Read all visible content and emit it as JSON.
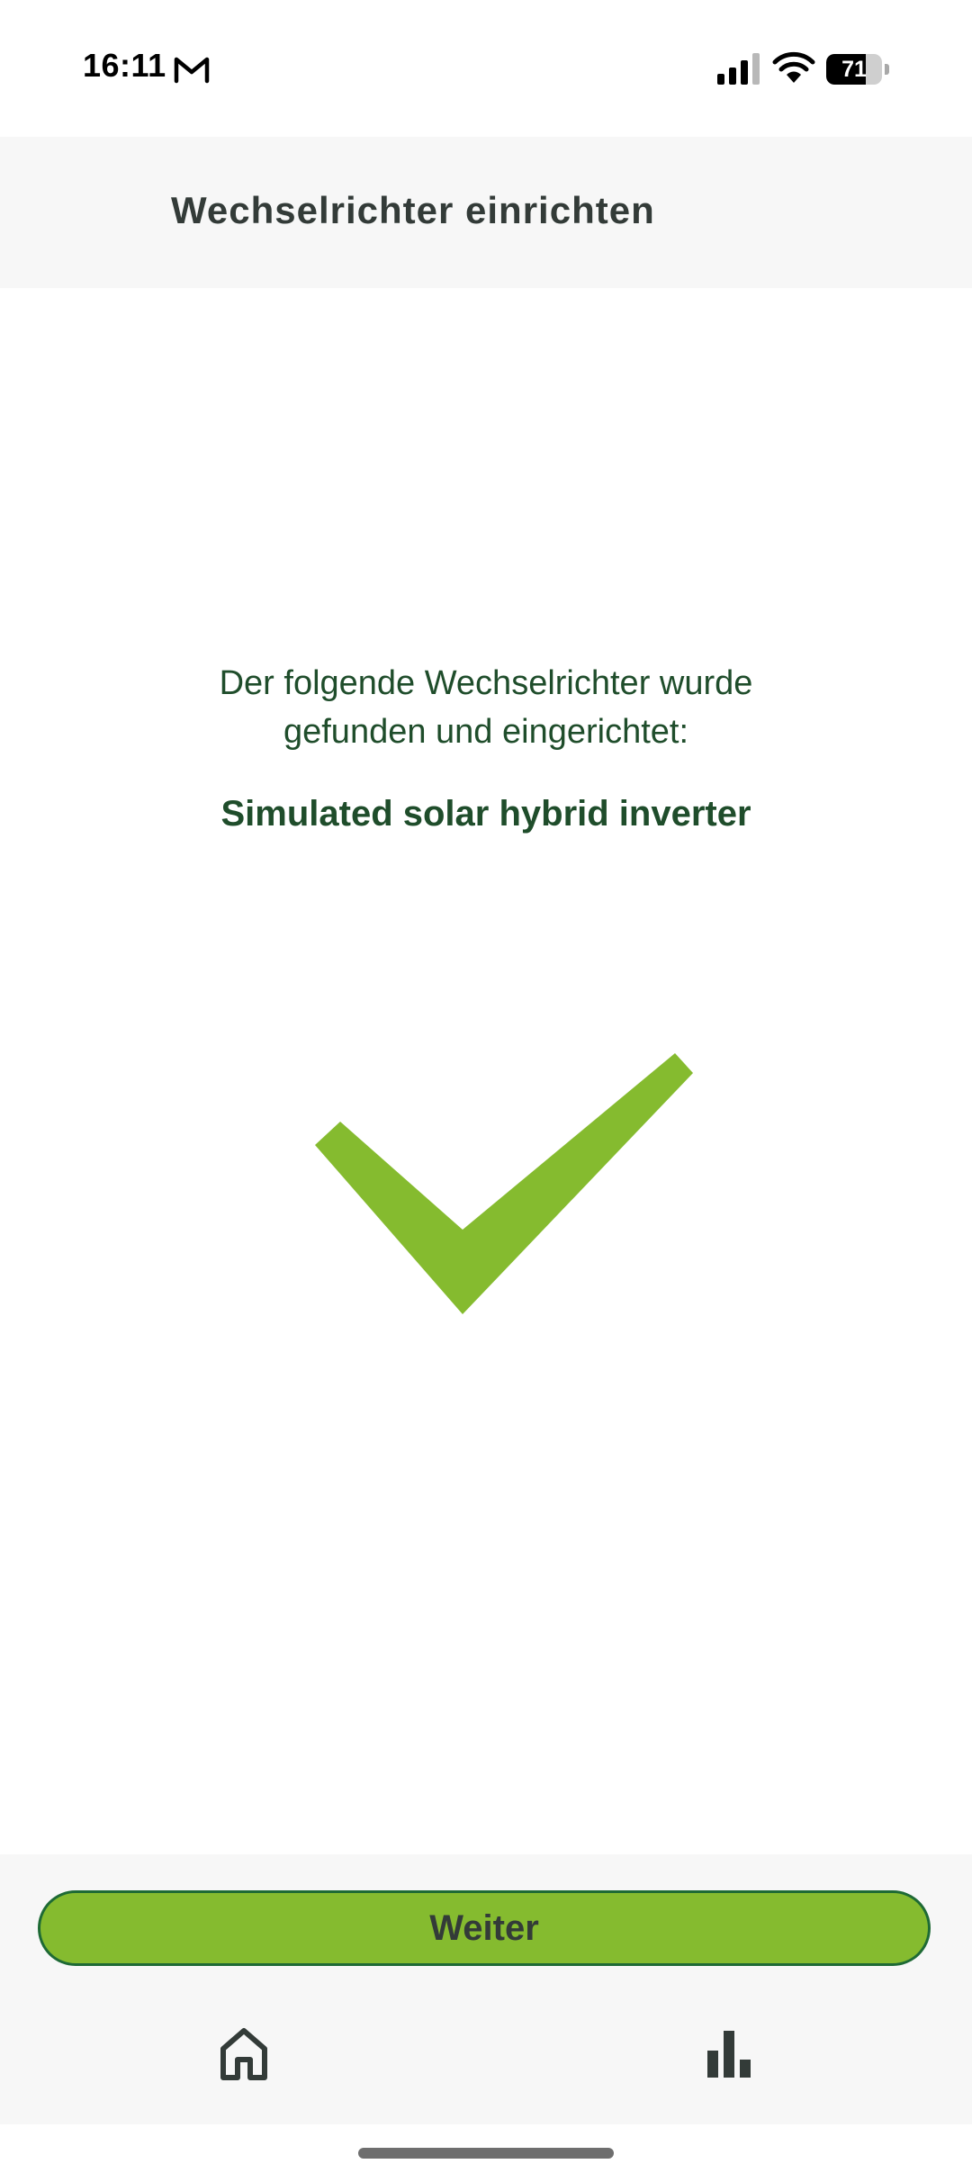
{
  "status_bar": {
    "time": "16:11",
    "battery_level": 71,
    "battery_text": "71",
    "icons": [
      "gmail-icon",
      "cellular-signal-icon",
      "wifi-icon",
      "battery-icon"
    ]
  },
  "header": {
    "title": "Wechselrichter einrichten"
  },
  "main": {
    "message_line1": "Der folgende Wechselrichter wurde",
    "message_line2": "gefunden und eingerichtet:",
    "device_name": "Simulated solar hybrid inverter",
    "status_icon": "checkmark-icon"
  },
  "footer": {
    "continue_label": "Weiter"
  },
  "bottom_nav": {
    "items": [
      {
        "icon": "home-icon"
      },
      {
        "icon": "bar-chart-icon"
      }
    ]
  },
  "colors": {
    "accent_green": "#85bb2f",
    "dark_green_text": "#1f4d2b",
    "button_border": "#1e6a35",
    "header_text": "#333b38",
    "header_bg": "#f7f7f7"
  }
}
